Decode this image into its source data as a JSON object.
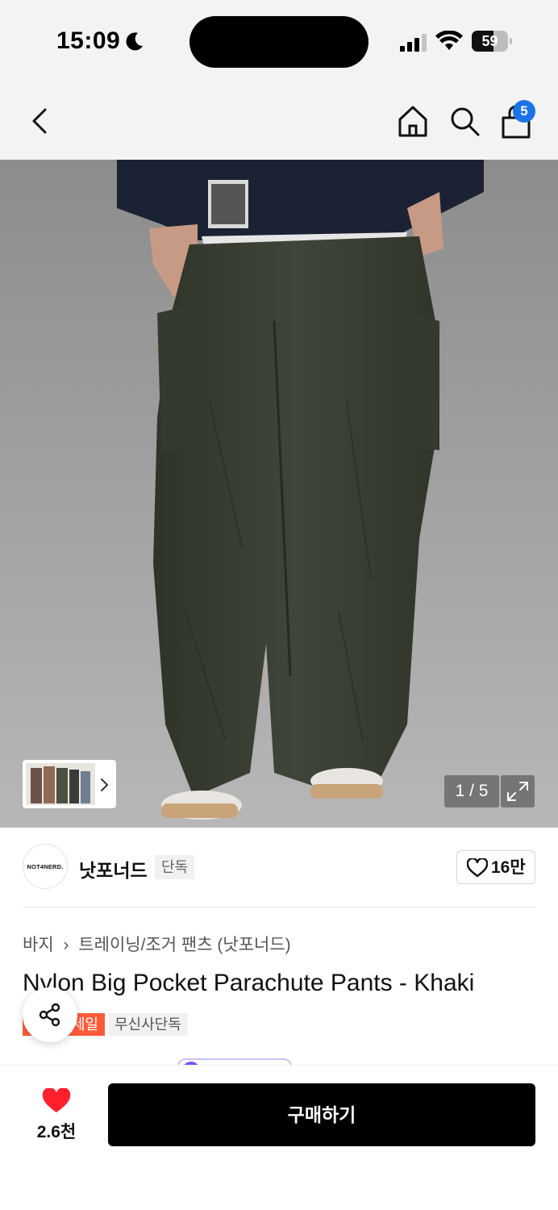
{
  "status_bar": {
    "time": "15:09",
    "battery_level": "59",
    "battery_fraction": 0.59,
    "icons": [
      "moon-icon",
      "signal-icon",
      "wifi-icon",
      "battery-icon"
    ]
  },
  "nav": {
    "icons": [
      "back-icon",
      "home-icon",
      "search-icon",
      "cart-icon"
    ],
    "cart_badge": "5",
    "badge_color": "#1a73e8"
  },
  "gallery": {
    "page_indicator": "1 / 5",
    "icons": [
      "chevron-right-icon",
      "expand-icon"
    ]
  },
  "brand": {
    "logo_text": "NOT4NERD.",
    "name": "낫포너드",
    "exclusive_tag": "단독",
    "like_count": "16만"
  },
  "product": {
    "breadcrumb": [
      "바지",
      "트레이닝/조거 팬츠 (낫포너드)"
    ],
    "title": "Nylon Big Pocket Parachute Pants - Khaki",
    "tags": {
      "sale": "세일",
      "exclusive": "무신사단독"
    },
    "sale_color": "#ff5b3a"
  },
  "bottom_bar": {
    "wish_count": "2.6천",
    "buy_label": "구매하기",
    "heart_color": "#ff1f2d"
  }
}
